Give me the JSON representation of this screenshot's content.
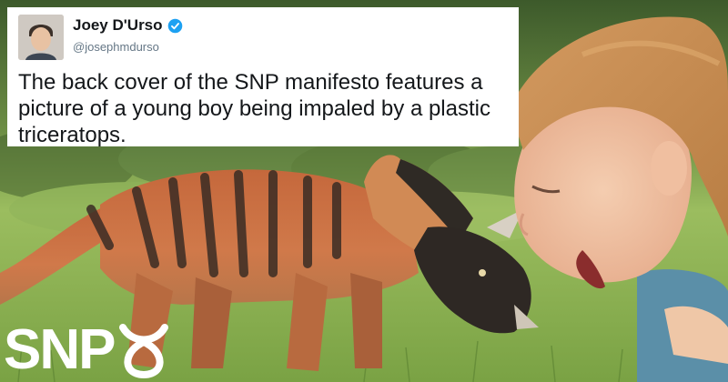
{
  "tweet": {
    "display_name": "Joey D'Urso",
    "handle": "@josephmdurso",
    "text": "The back cover of the SNP manifesto features a picture of a young boy being impaled by a plastic triceratops.",
    "verified": true,
    "verified_color": "#1da1f2",
    "avatar_icon": "profile-photo"
  },
  "logo": {
    "text": "SNP",
    "mark_icon": "snp-loop-mark",
    "color": "#ffffff"
  },
  "photo": {
    "subject_1": "toy-triceratops",
    "subject_2": "boy-face",
    "background": "grass-field"
  }
}
